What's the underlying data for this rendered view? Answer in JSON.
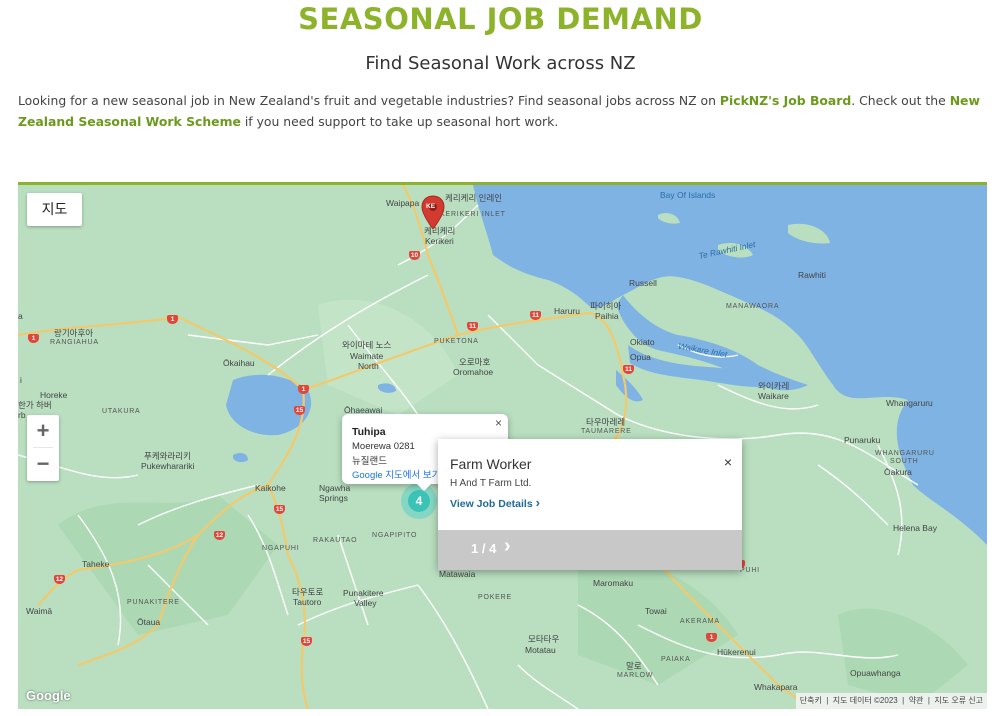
{
  "header": {
    "title": "SEASONAL JOB DEMAND",
    "subtitle": "Find Seasonal Work across NZ"
  },
  "intro": {
    "text1": "Looking for a new seasonal job in New Zealand's fruit and vegetable industries? Find seasonal jobs across NZ on ",
    "link1": "PickNZ's Job Board",
    "text2": ". Check out the ",
    "link2": "New Zealand Seasonal Work Scheme",
    "text3": " if you need support to take up seasonal hort work."
  },
  "map": {
    "map_type_label": "지도",
    "zoom_in": "+",
    "zoom_out": "−",
    "cluster_count": "4",
    "pin_letter": "KE",
    "google_logo": "Google",
    "attribution": [
      "단축키",
      "지도 데이터 ©2023",
      "약관",
      "지도 오류 신고"
    ],
    "colors": {
      "land": "#b9dfc0",
      "water": "#7fb3e4",
      "road_major": "#f3c96b",
      "road_minor": "#ffffff",
      "accent": "#8db32b"
    },
    "labels": {
      "waipapa": "Waipapa",
      "kerikeri_ko": "케리케리",
      "kerikeri": "Kerikeri",
      "kerikeri_inlet": "KERIKERI INLET",
      "bay_of_islands": "Bay Of Islands",
      "te_rawhiti_inlet": "Te Rawhiti Inlet",
      "rawhiti": "Rawhiti",
      "russell": "Russell",
      "manawaora": "MANAWAORA",
      "haruru": "Haruru",
      "paihia_ko": "파이히아",
      "paihia": "Paihia",
      "okiato": "Okiato",
      "opua": "Opua",
      "waikare_inlet": "Waikare Inlet",
      "waikare_ko": "와이카레",
      "waikare": "Waikare",
      "whangaruru": "Whangaruru",
      "punaruku": "Punaruku",
      "whangaruru_south": "WHANGARURU SOUTH",
      "oakura": "Ōakura",
      "helena_bay": "Helena Bay",
      "rangiahua_ko": "랑기아후아",
      "rangiahua": "RANGIAHUA",
      "okaihau": "Ōkaihau",
      "waimate_ko": "와이마테 노스",
      "waimate": "Waimate",
      "north": "North",
      "puketona": "PUKETONA",
      "oromahoe_ko": "오로마호",
      "oromahoe": "Oromahoe",
      "horeke": "Horeke",
      "utakura": "UTAKURA",
      "ohaeawai": "Ōhaeawai",
      "taumarere_ko": "타우마레레",
      "taumarere": "TAUMARERE",
      "pukewharariki_ko": "푸케와라리키",
      "pukewharariki": "Pukewharariki",
      "kaikohe": "Kaikohe",
      "ngawha": "Ngawha",
      "springs": "Springs",
      "ngapuhi": "NGAPUHI",
      "rakautao": "RAKAUTAO",
      "ngapipito": "NGAPIPITO",
      "taheke": "Taheke",
      "tautoro_ko": "타우토로",
      "tautoro": "Tautoro",
      "punakitere": "Punakitere",
      "valley": "Valley",
      "matawaia": "Matawaia",
      "pokere": "POKERE",
      "maromaku": "Maromaku",
      "towai": "Towai",
      "akerama": "AKERAMA",
      "waima": "Waimā",
      "punakitere_caps": "PUNAKITERE",
      "otaua": "Ōtaua",
      "motatau_ko": "모타타우",
      "motatau": "Motatau",
      "paiaka": "PAIAKA",
      "marlow_ko": "말로",
      "marlow": "MARLOW",
      "hukerenui": "Hūkerenui",
      "whakapara": "Whakapara",
      "opuawhanga": "Opuawhanga",
      "hupuhi": "PUHI",
      "left1": "한가 하버",
      "left2": "rb",
      "left_a": "a",
      "left_i": "i"
    },
    "shields": [
      "10",
      "11",
      "11",
      "1",
      "1",
      "1",
      "15",
      "15",
      "12",
      "12",
      "15",
      "11",
      "1",
      "1"
    ]
  },
  "tuhipa_popup": {
    "name": "Tuhipa",
    "line1": "Moerewa 0281",
    "line2": "뉴질랜드",
    "link": "Google 지도에서 보기",
    "close": "×"
  },
  "job_popup": {
    "title": "Farm Worker",
    "company": "H And T Farm Ltd.",
    "link": "View Job Details",
    "link_chevron": "›",
    "close": "×",
    "pager": "1 / 4",
    "next": "›"
  }
}
